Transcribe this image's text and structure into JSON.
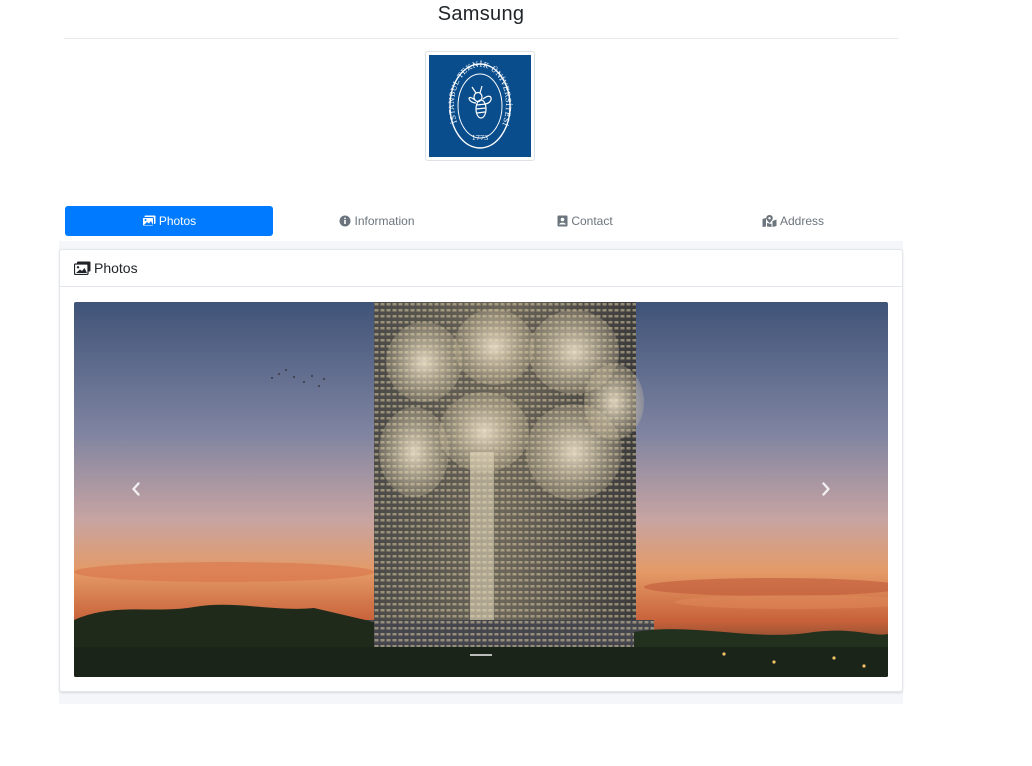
{
  "page": {
    "title": "Samsung"
  },
  "logo": {
    "icon": "university-seal-icon",
    "ring_text": "İSTANBUL TEKNİK ÜNİVERSİTESİ",
    "year": "1773",
    "bg_color": "#0a4d8c"
  },
  "tabs": [
    {
      "label": "Photos",
      "icon": "images-icon",
      "active": true
    },
    {
      "label": "Information",
      "icon": "info-circle-icon",
      "active": false
    },
    {
      "label": "Contact",
      "icon": "contact-card-icon",
      "active": false
    },
    {
      "label": "Address",
      "icon": "map-marked-icon",
      "active": false
    }
  ],
  "photos_card": {
    "title": "Photos",
    "icon": "images-icon"
  },
  "carousel": {
    "slide_count": 1,
    "active_slide": 1,
    "prev_icon": "chevron-left-icon",
    "next_icon": "chevron-right-icon"
  },
  "colors": {
    "accent": "#007bff",
    "muted": "#6c757d",
    "band": "#f4f6f9"
  }
}
